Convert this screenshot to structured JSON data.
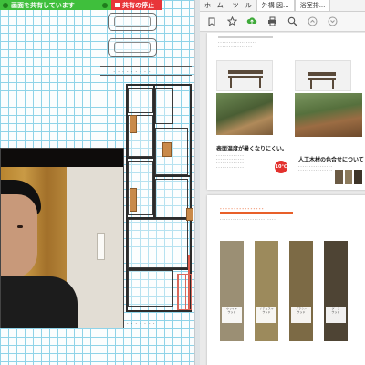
{
  "share_bar": {
    "status_label": "画面を共有しています",
    "stop_label": "共有の停止",
    "colors": {
      "status": "#3fbf3c",
      "stop": "#e8353a"
    }
  },
  "viewer": {
    "tabs": [
      "ホーム",
      "ツール",
      "外構 図...",
      "浴室排..."
    ],
    "toolbar_icons": [
      "bookmark-icon",
      "star-icon",
      "upload-icon",
      "print-icon",
      "zoom-icon",
      "page-up-icon",
      "page-down-icon"
    ],
    "page1": {
      "section_title": "表面温度が暑くなりにくい。",
      "section_title_2": "人工木材の色合せについて",
      "thermo_label": "10℃"
    },
    "page2": {
      "swatches": [
        {
          "label": "ホワイト\nウッド",
          "color": "#9b8f74"
        },
        {
          "label": "ナチュラル\nウッド",
          "color": "#9c8a5c"
        },
        {
          "label": "ブラウン\nウッド",
          "color": "#7c6a45"
        },
        {
          "label": "ダーク\nウッド",
          "color": "#4e4434"
        }
      ]
    }
  }
}
